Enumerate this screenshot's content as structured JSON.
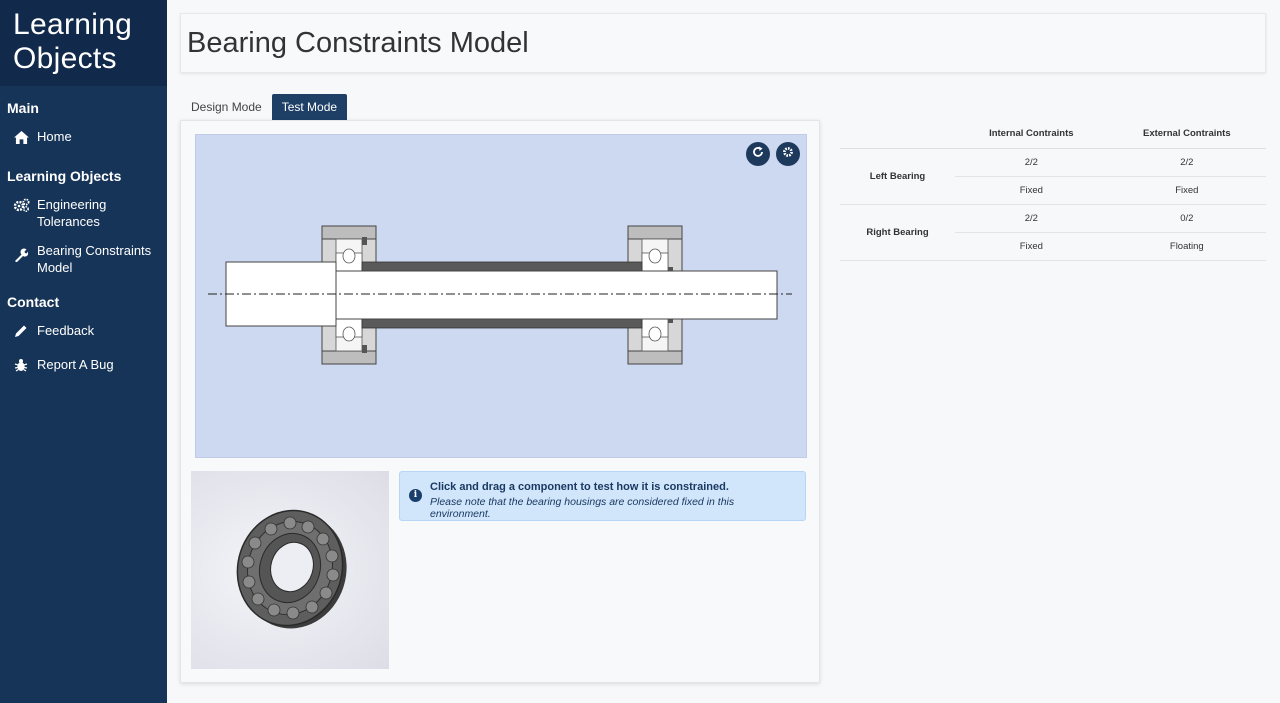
{
  "sidebar": {
    "brand_line1": "Learning",
    "brand_line2": "Objects",
    "sections": [
      {
        "title": "Main",
        "items": [
          {
            "label": "Home",
            "icon": "home-icon"
          }
        ]
      },
      {
        "title": "Learning Objects",
        "items": [
          {
            "label": "Engineering Tolerances",
            "icon": "gears-icon"
          },
          {
            "label": "Bearing Constraints Model",
            "icon": "wrench-icon"
          }
        ]
      },
      {
        "title": "Contact",
        "items": [
          {
            "label": "Feedback",
            "icon": "pencil-icon"
          },
          {
            "label": "Report A Bug",
            "icon": "bug-icon"
          }
        ]
      }
    ]
  },
  "header": {
    "title": "Bearing Constraints Model"
  },
  "tabs": [
    {
      "label": "Design Mode",
      "active": false
    },
    {
      "label": "Test Mode",
      "active": true
    }
  ],
  "canvas": {
    "background": "#cdd9f0",
    "buttons": [
      {
        "icon": "reset-icon"
      },
      {
        "icon": "gear-icon"
      }
    ]
  },
  "alert": {
    "title": "Click and drag a component to test how it is constrained.",
    "note": "Please note that the bearing housings are considered fixed in this environment."
  },
  "constraints": {
    "columns": [
      "",
      "Internal Contraints",
      "External Contraints"
    ],
    "groups": [
      {
        "label": "Left Bearing",
        "rows": [
          [
            "2/2",
            "2/2"
          ],
          [
            "Fixed",
            "Fixed"
          ]
        ]
      },
      {
        "label": "Right Bearing",
        "rows": [
          [
            "2/2",
            "0/2"
          ],
          [
            "Fixed",
            "Floating"
          ]
        ]
      }
    ]
  },
  "colors": {
    "sidebar": "#163457",
    "brand": "#11294a",
    "accent": "#1e3f66",
    "alert_bg": "#d1e5fb"
  }
}
